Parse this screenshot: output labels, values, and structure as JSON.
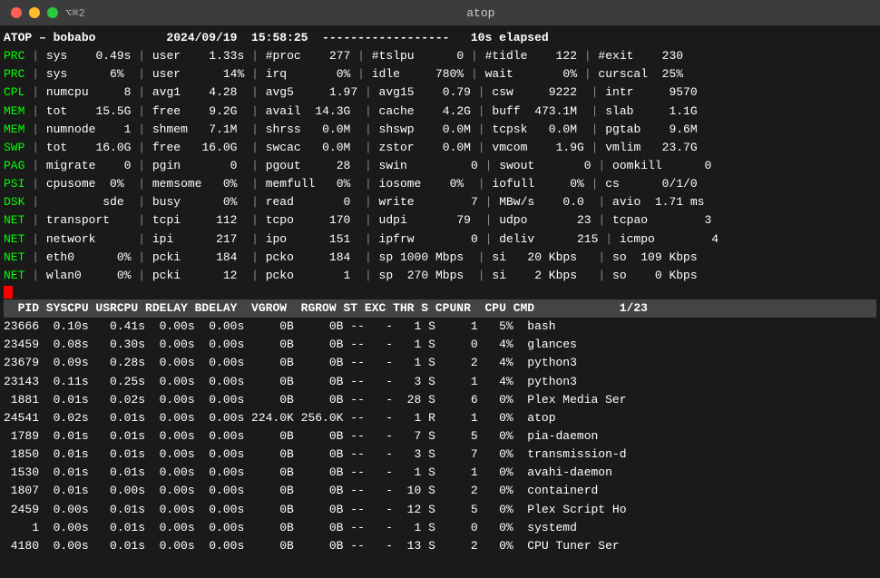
{
  "titlebar": {
    "title": "atop",
    "keyboard_shortcut": "⌥⌘2"
  },
  "header_line": "ATOP – bobabo          2024/09/19  15:58:25  ------------------   10s elapsed",
  "system_lines": [
    "PRC | sys    0.49s | user    1.33s | #proc    277 | #tslpu      0 | #tidle    122 | #exit    230",
    "PRC | sys      6%  | user      14% | irq       0% | idle     780% | wait       0% | curscal  25%",
    "CPL | numcpu     8 | avg1    4.28  | avg5     1.97 | avg15    0.79 | csw     9222  | intr     9570",
    "MEM | tot    15.5G | free    9.2G  | avail  14.3G  | cache    4.2G | buff  473.1M  | slab     1.1G",
    "MEM | numnode    1 | shmem   7.1M  | shrss   0.0M  | shswp    0.0M | tcpsk   0.0M  | pgtab    9.6M",
    "SWP | tot    16.0G | free   16.0G  | swcac   0.0M  | zstor    0.0M | vmcom    1.9G | vmlim   23.7G",
    "PAG | migrate    0 | pgin       0  | pgout     28  | swin         0 | swout       0 | oomkill      0",
    "PSI | cpusome  0%  | memsome   0%  | memfull   0%  | iosome    0%  | iofull     0% | cs      0/1/0",
    "DSK |         sde  | busy      0%  | read       0  | write        7 | MBw/s    0.0  | avio  1.71 ms",
    "NET | transport    | tcpi     112  | tcpo     170  | udpi       79  | udpo       23 | tcpao        3",
    "NET | network      | ipi      217  | ipo      151  | ipfrw        0 | deliv      215 | icmpo        4",
    "NET | eth0      0% | pcki     184  | pcko     184  | sp 1000 Mbps  | si   20 Kbps   | so  109 Kbps",
    "NET | wlan0     0% | pcki      12  | pcko       1  | sp  270 Mbps  | si    2 Kbps   | so    0 Kbps"
  ],
  "process_header": "  PID SYSCPU USRCPU RDELAY BDELAY  VGROW  RGROW ST EXC THR S CPUNR  CPU CMD            1/23",
  "processes": [
    "23666  0.10s   0.41s  0.00s  0.00s     0B     0B --   -   1 S     1   5%  bash",
    "23459  0.08s   0.30s  0.00s  0.00s     0B     0B --   -   1 S     0   4%  glances",
    "23679  0.09s   0.28s  0.00s  0.00s     0B     0B --   -   1 S     2   4%  python3",
    "23143  0.11s   0.25s  0.00s  0.00s     0B     0B --   -   3 S     1   4%  python3",
    " 1881  0.01s   0.02s  0.00s  0.00s     0B     0B --   -  28 S     6   0%  Plex Media Ser",
    "24541  0.02s   0.01s  0.00s  0.00s 224.0K 256.0K --   -   1 R     1   0%  atop",
    " 1789  0.01s   0.01s  0.00s  0.00s     0B     0B --   -   7 S     5   0%  pia-daemon",
    " 1850  0.01s   0.01s  0.00s  0.00s     0B     0B --   -   3 S     7   0%  transmission-d",
    " 1530  0.01s   0.01s  0.00s  0.00s     0B     0B --   -   1 S     1   0%  avahi-daemon",
    " 1807  0.01s   0.00s  0.00s  0.00s     0B     0B --   -  10 S     2   0%  containerd",
    " 2459  0.00s   0.01s  0.00s  0.00s     0B     0B --   -  12 S     5   0%  Plex Script Ho",
    "    1  0.00s   0.01s  0.00s  0.00s     0B     0B --   -   1 S     0   0%  systemd",
    " 4180  0.00s   0.01s  0.00s  0.00s     0B     0B --   -  13 S     2   0%  CPU Tuner Ser"
  ]
}
